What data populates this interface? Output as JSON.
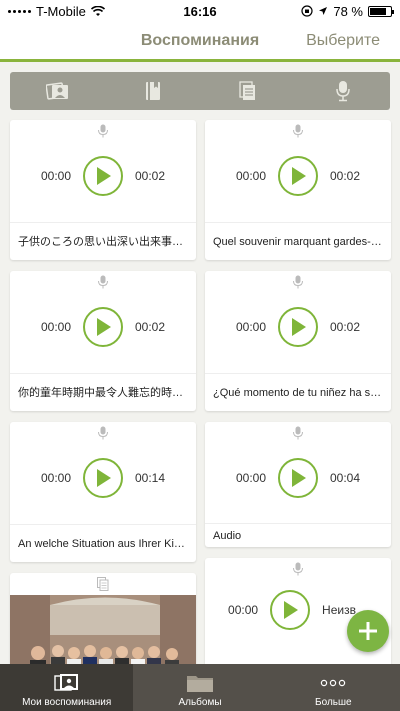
{
  "status_bar": {
    "carrier": "T-Mobile",
    "time": "16:16",
    "battery_percent": "78 %",
    "battery_level": 0.78
  },
  "nav": {
    "title": "Воспоминания",
    "action_label": "Выберите"
  },
  "filters": [
    {
      "icon": "photo-icon"
    },
    {
      "icon": "book-icon"
    },
    {
      "icon": "document-icon"
    },
    {
      "icon": "microphone-icon"
    }
  ],
  "memories": [
    {
      "type": "audio",
      "current_time": "00:00",
      "duration": "00:02",
      "caption": "子供のころの思い出深い出来事は…"
    },
    {
      "type": "audio",
      "current_time": "00:00",
      "duration": "00:02",
      "caption": "Quel souvenir marquant gardes-…"
    },
    {
      "type": "audio",
      "current_time": "00:00",
      "duration": "00:02",
      "caption": "你的童年時期中最令人難忘的時刻…"
    },
    {
      "type": "audio",
      "current_time": "00:00",
      "duration": "00:02",
      "caption": "¿Qué momento de tu niñez ha si…"
    },
    {
      "type": "audio",
      "current_time": "00:00",
      "duration": "00:14",
      "caption": "An welche Situation aus Ihrer Kin…"
    },
    {
      "type": "audio",
      "current_time": "00:00",
      "duration": "00:04",
      "caption": "Audio"
    },
    {
      "type": "photo",
      "caption": ""
    },
    {
      "type": "audio",
      "current_time": "00:00",
      "duration": "Неизв…",
      "caption": ""
    }
  ],
  "tabs": [
    {
      "label": "Мои воспоминания",
      "icon": "memories-icon",
      "active": true
    },
    {
      "label": "Альбомы",
      "icon": "folder-icon",
      "active": false
    },
    {
      "label": "Больше",
      "icon": "more-icon",
      "active": false
    }
  ],
  "fab": {
    "icon": "plus-icon"
  },
  "colors": {
    "accent": "#7db543",
    "nav_text": "#8c8c76",
    "tab_bar": "#54504a"
  }
}
